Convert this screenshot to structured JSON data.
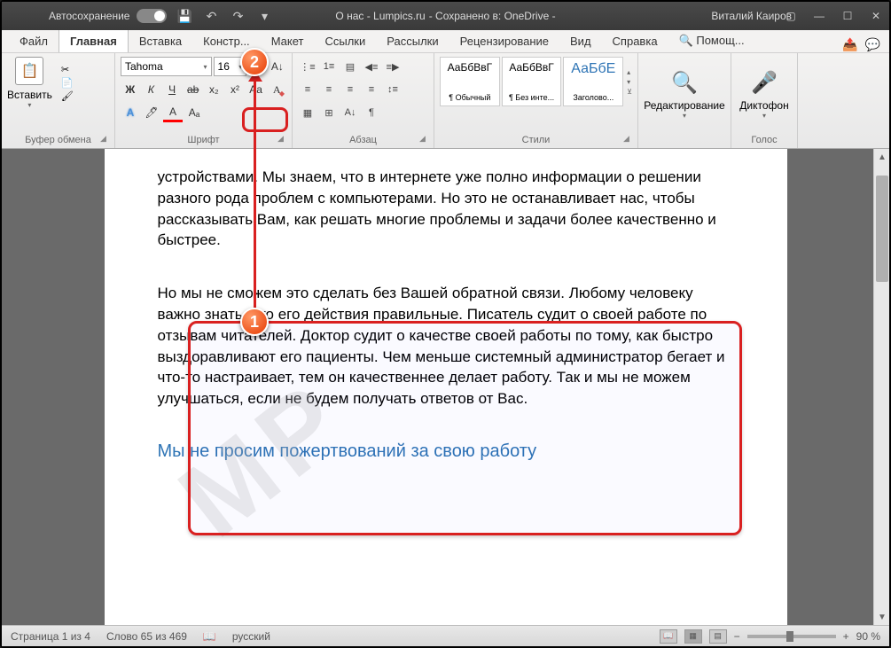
{
  "titlebar": {
    "autosave": "Автосохранение",
    "doc_title": "О нас - Lumpics.ru",
    "saved_to": "- Сохранено в: OneDrive -",
    "user": "Виталий Каиров"
  },
  "tabs": {
    "file": "Файл",
    "home": "Главная",
    "insert": "Вставка",
    "design": "Констр...",
    "layout": "Макет",
    "references": "Ссылки",
    "mailings": "Рассылки",
    "review": "Рецензирование",
    "view": "Вид",
    "help": "Справка",
    "search": "Помощ..."
  },
  "ribbon": {
    "clipboard": {
      "paste": "Вставить",
      "label": "Буфер обмена"
    },
    "font": {
      "name": "Tahoma",
      "size": "16",
      "label": "Шрифт"
    },
    "paragraph": {
      "label": "Абзац"
    },
    "styles": {
      "label": "Стили",
      "preview": "АаБбВвГ",
      "s1_name": "¶ Обычный",
      "s2_name": "¶ Без инте...",
      "s3_name": "Заголово...",
      "preview_big": "АаБбЕ"
    },
    "editing": {
      "label": "Редактирование"
    },
    "voice": {
      "btn": "Диктофон",
      "label": "Голос"
    }
  },
  "document": {
    "para1": "устройствами. Мы знаем, что в интернете уже полно информации о решении разного рода проблем с компьютерами. Но это не останавливает нас, чтобы рассказывать Вам, как решать многие проблемы и задачи более качественно и быстрее.",
    "para2": "Но мы не сможем это сделать без Вашей обратной связи. Любому человеку важно знать, что его действия правильные. Писатель судит о своей работе по отзывам читателей. Доктор судит о качестве своей работы по тому, как быстро выздоравливают его пациенты. Чем меньше системный администратор бегает и что-то настраивает, тем он качественнее делает работу. Так и мы не можем улучшаться, если не будем получать ответов от Вас.",
    "heading": "Мы не просим пожертвований за свою работу"
  },
  "callouts": {
    "n1": "1",
    "n2": "2"
  },
  "status": {
    "page": "Страница 1 из 4",
    "words": "Слово 65 из 469",
    "lang": "русский",
    "zoom": "90 %"
  }
}
